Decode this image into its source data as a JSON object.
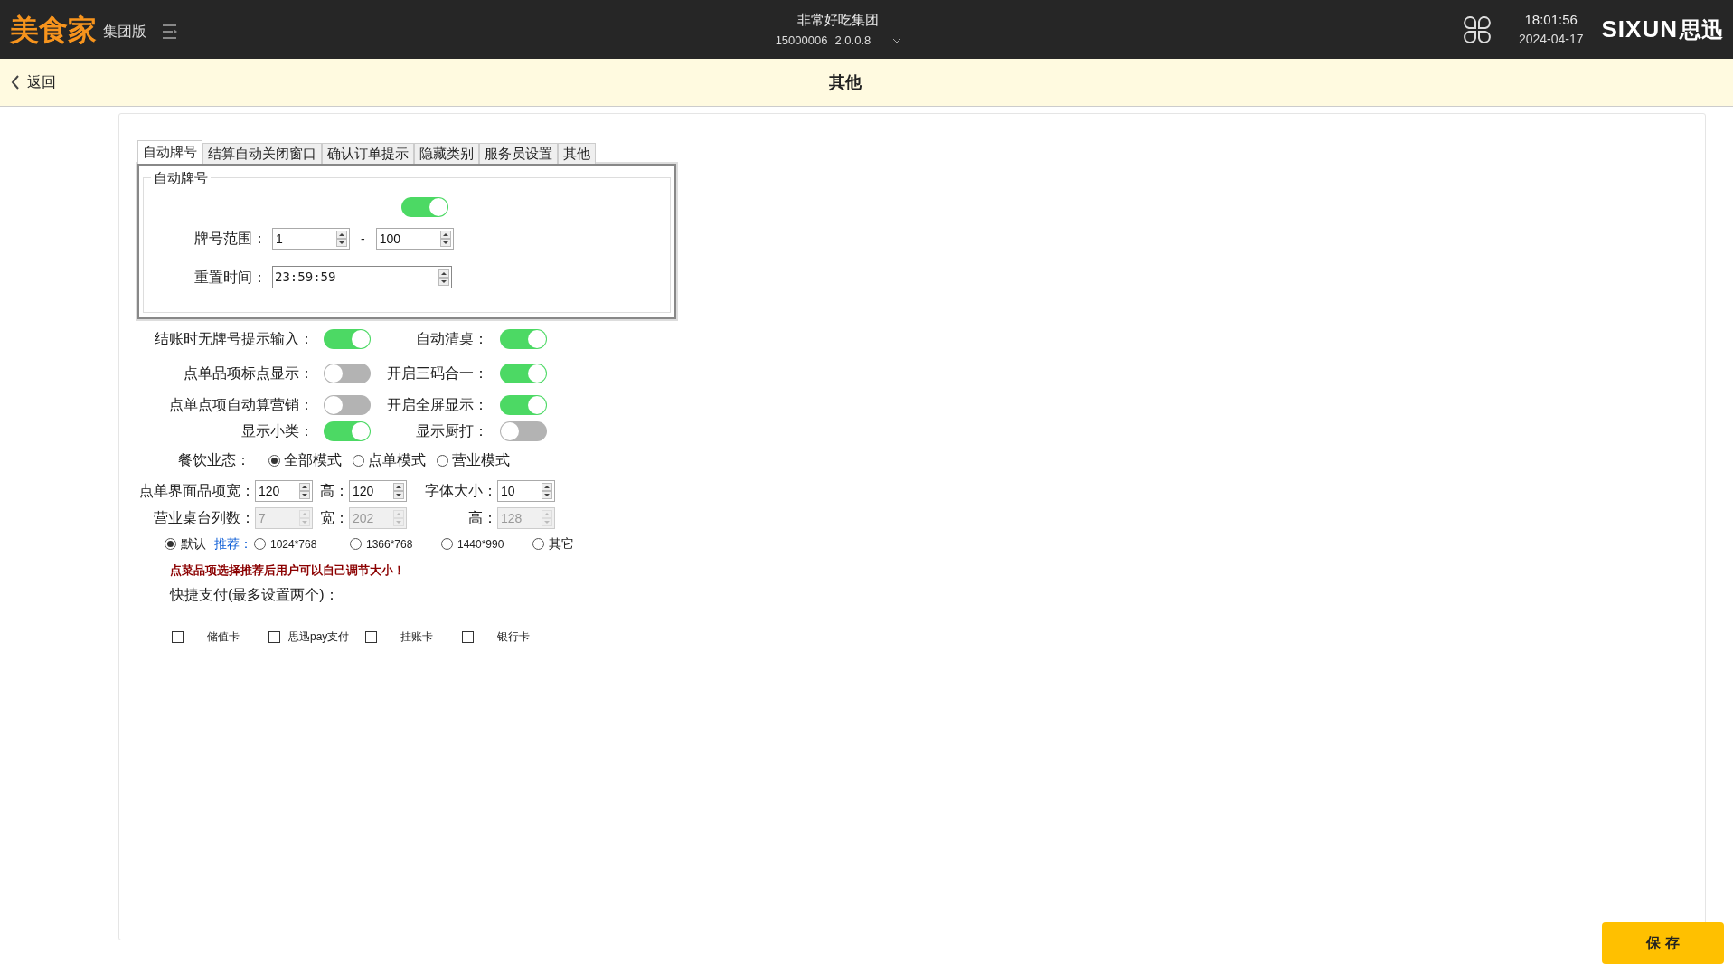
{
  "header": {
    "brand": "美食家",
    "edition": "集团版",
    "company": "非常好吃集团",
    "account": "15000006",
    "version": "2.0.0.8",
    "time": "18:01:56",
    "date": "2024-04-17",
    "logo_text": "SIXUN",
    "logo_cn": "思迅"
  },
  "subbar": {
    "back": "返回",
    "title": "其他"
  },
  "tabs": [
    {
      "label": "自动牌号",
      "selected": true
    },
    {
      "label": "结算自动关闭窗口",
      "selected": false
    },
    {
      "label": "确认订单提示",
      "selected": false
    },
    {
      "label": "隐藏类别",
      "selected": false
    },
    {
      "label": "服务员设置",
      "selected": false
    },
    {
      "label": "其他",
      "selected": false
    }
  ],
  "group": {
    "title": "自动牌号",
    "on": true,
    "range_label": "牌号范围：",
    "range_from": "1",
    "range_sep": "-",
    "range_to": "100",
    "reset_label": "重置时间：",
    "reset_value": "23:59:59"
  },
  "toggles": [
    {
      "label": "结账时无牌号提示输入：",
      "on": true
    },
    {
      "label": "自动清桌：",
      "on": true
    },
    {
      "label": "点单品项标点显示：",
      "on": false
    },
    {
      "label": "开启三码合一：",
      "on": true
    },
    {
      "label": "点单点项自动算营销：",
      "on": false
    },
    {
      "label": "开启全屏显示：",
      "on": true
    },
    {
      "label": "显示小类：",
      "on": true
    },
    {
      "label": "显示厨打：",
      "on": false
    }
  ],
  "mode": {
    "label": "餐饮业态：",
    "options": [
      {
        "label": "全部模式",
        "selected": true
      },
      {
        "label": "点单模式",
        "selected": false
      },
      {
        "label": "营业模式",
        "selected": false
      }
    ]
  },
  "spin_rows": [
    [
      {
        "label": "点单界面品项宽：",
        "value": "120",
        "disabled": false
      },
      {
        "label": "高：",
        "value": "120",
        "disabled": false
      },
      {
        "label": "字体大小：",
        "value": "10",
        "disabled": false
      }
    ],
    [
      {
        "label": "营业桌台列数：",
        "value": "7",
        "disabled": true
      },
      {
        "label": "宽：",
        "value": "202",
        "disabled": true
      },
      {
        "label": "高：",
        "value": "128",
        "disabled": true
      }
    ]
  ],
  "resolution": {
    "recommend_label": "推荐：",
    "options": [
      {
        "label": "默认",
        "selected": true
      },
      {
        "label": "1024*768",
        "selected": false
      },
      {
        "label": "1366*768",
        "selected": false
      },
      {
        "label": "1440*990",
        "selected": false
      },
      {
        "label": "其它",
        "selected": false
      }
    ]
  },
  "notice": "点菜品项选择推荐后用户可以自己调节大小！",
  "quick_pay": {
    "label": "快捷支付(最多设置两个)：",
    "options": [
      {
        "label": "储值卡",
        "checked": false
      },
      {
        "label": "思迅pay支付",
        "checked": false
      },
      {
        "label": "挂账卡",
        "checked": false
      },
      {
        "label": "银行卡",
        "checked": false
      }
    ]
  },
  "save_button": "保 存"
}
